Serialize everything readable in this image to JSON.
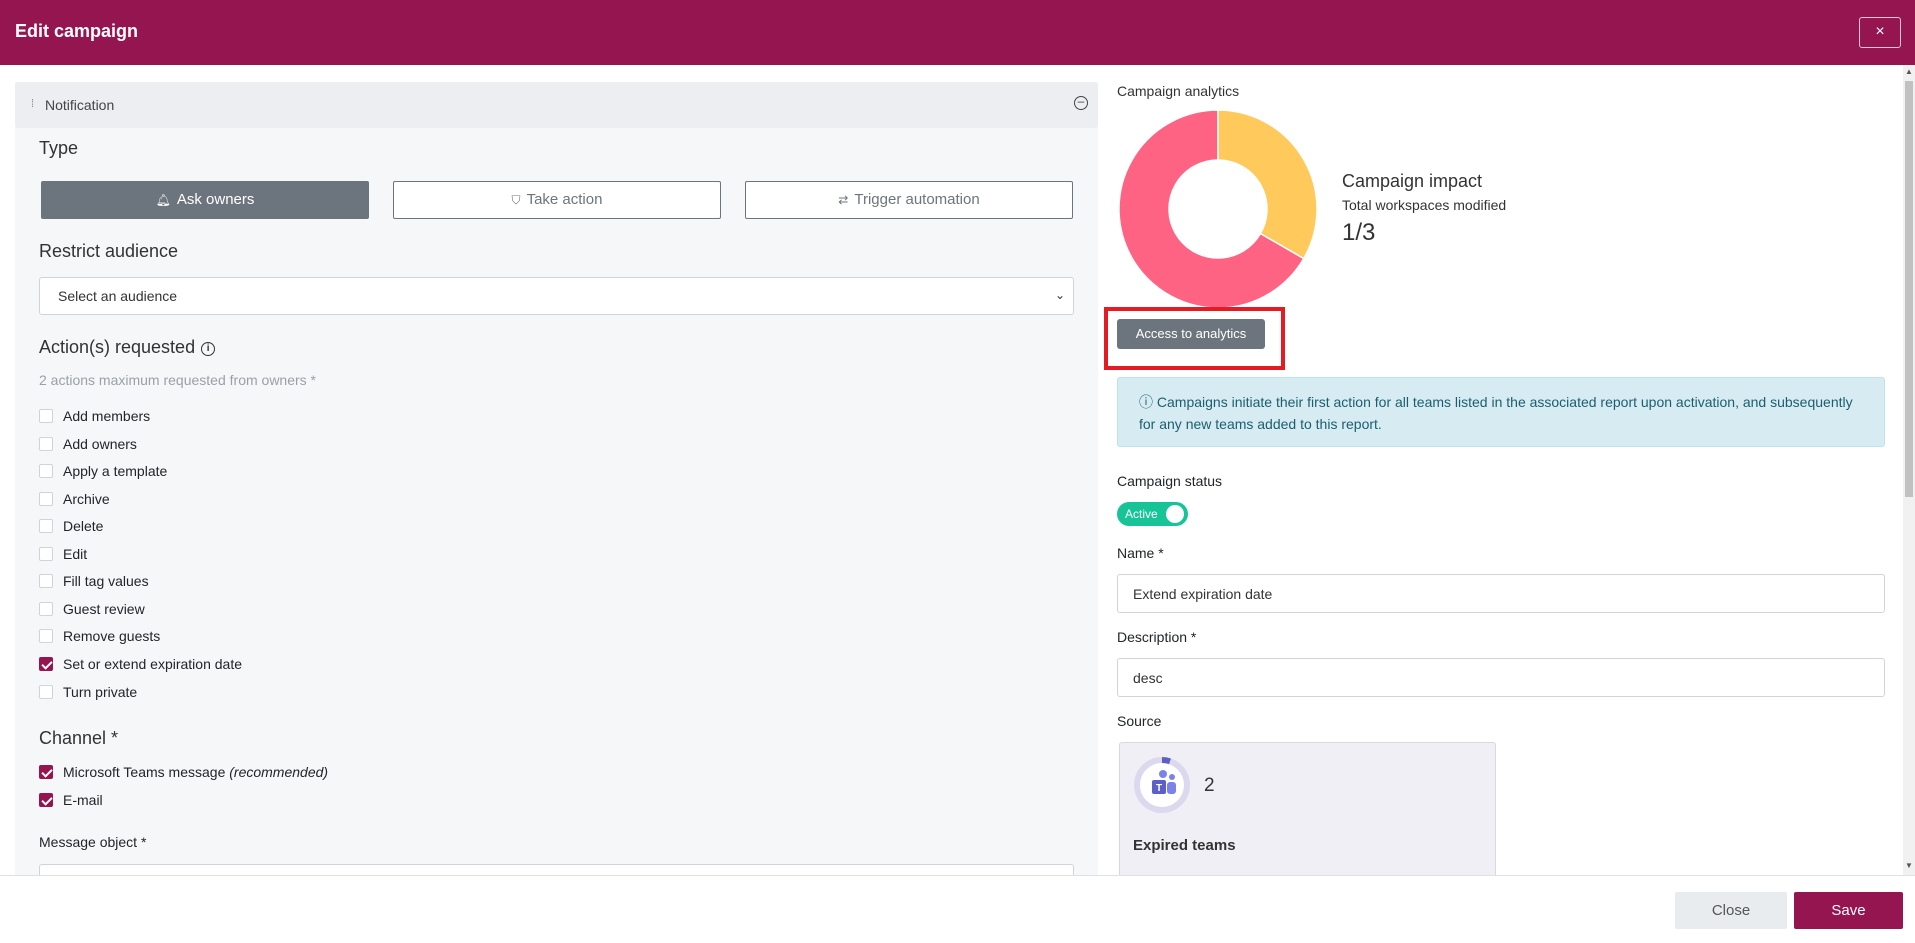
{
  "header": {
    "title": "Edit campaign",
    "close_glyph": "×"
  },
  "left": {
    "panel_title": "Notification",
    "type_title": "Type",
    "type_buttons": [
      {
        "label": "Ask owners",
        "icon": "bell-icon",
        "active": true
      },
      {
        "label": "Take action",
        "icon": "shield-check-icon",
        "active": false
      },
      {
        "label": "Trigger automation",
        "icon": "automation-icon",
        "active": false
      }
    ],
    "audience_title": "Restrict audience",
    "audience_select_value": "Select an audience",
    "actions_title": "Action(s) requested",
    "actions_hint": "2 actions maximum requested from owners *",
    "actions": [
      {
        "label": "Add members",
        "checked": false
      },
      {
        "label": "Add owners",
        "checked": false
      },
      {
        "label": "Apply a template",
        "checked": false
      },
      {
        "label": "Archive",
        "checked": false
      },
      {
        "label": "Delete",
        "checked": false
      },
      {
        "label": "Edit",
        "checked": false
      },
      {
        "label": "Fill tag values",
        "checked": false
      },
      {
        "label": "Guest review",
        "checked": false
      },
      {
        "label": "Remove guests",
        "checked": false
      },
      {
        "label": "Set or extend expiration date",
        "checked": true
      },
      {
        "label": "Turn private",
        "checked": false
      }
    ],
    "channel_title": "Channel *",
    "channels": [
      {
        "label": "Microsoft Teams message",
        "suffix": "(recommended)",
        "checked": true
      },
      {
        "label": "E-mail",
        "suffix": "",
        "checked": true
      }
    ],
    "message_object_label": "Message object *"
  },
  "right": {
    "analytics_label": "Campaign analytics",
    "donut": {
      "modified": 1,
      "total": 3,
      "colors": [
        "#ffc95c",
        "#ff6384"
      ]
    },
    "impact_title": "Campaign impact",
    "impact_sub": "Total workspaces modified",
    "impact_value": "1/3",
    "analytics_button": "Access to analytics",
    "alert_text": "Campaigns initiate their first action for all teams listed in the associated report upon activation, and subsequently for any new teams added to this report.",
    "status_label": "Campaign status",
    "status_toggle": "Active",
    "name_label": "Name *",
    "name_value": "Extend expiration date",
    "description_label": "Description *",
    "description_value": "desc",
    "source_label": "Source",
    "source": {
      "count": "2",
      "name": "Expired teams",
      "icon": "teams-icon"
    }
  },
  "footer": {
    "close_label": "Close",
    "save_label": "Save"
  },
  "colors": {
    "brand": "#941550",
    "toggle_on": "#17c497",
    "highlight": "#e41b23"
  }
}
